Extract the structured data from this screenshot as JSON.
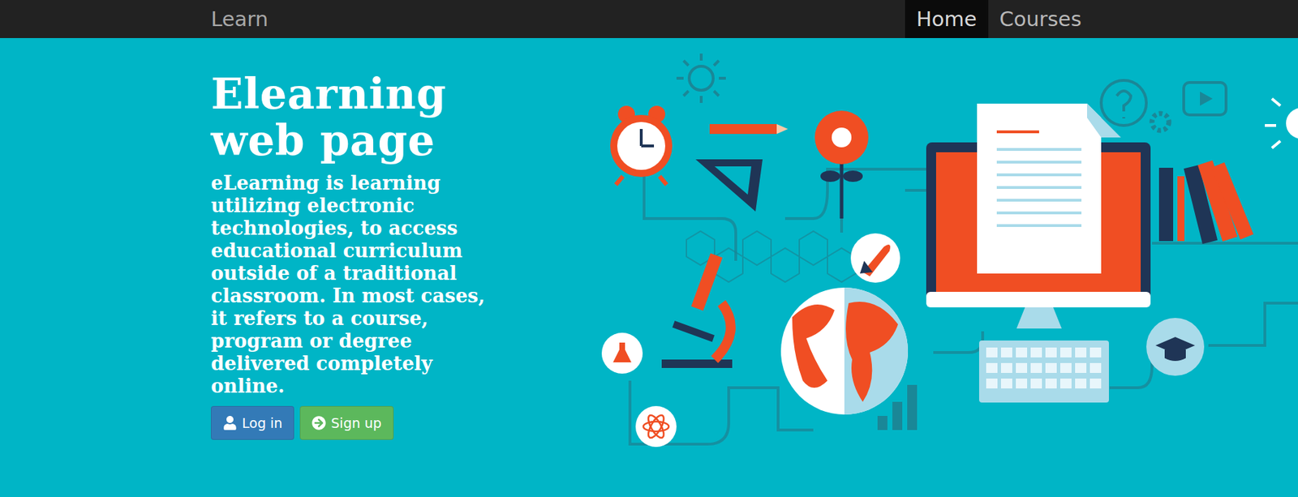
{
  "navbar": {
    "brand": "Learn",
    "links": [
      {
        "label": "Home",
        "selected": true
      },
      {
        "label": "Courses",
        "selected": false
      }
    ]
  },
  "hero": {
    "title": "Elearning web page",
    "description": "eLearning is learning utilizing electronic technologies, to access educational curriculum outside of a traditional classroom. In most cases, it refers to a course, program or degree delivered completely online.",
    "buttons": [
      {
        "label": "Log in",
        "kind": "login",
        "color": "#337ab7"
      },
      {
        "label": "Sign up",
        "kind": "signup",
        "color": "#5cb85c"
      }
    ]
  }
}
